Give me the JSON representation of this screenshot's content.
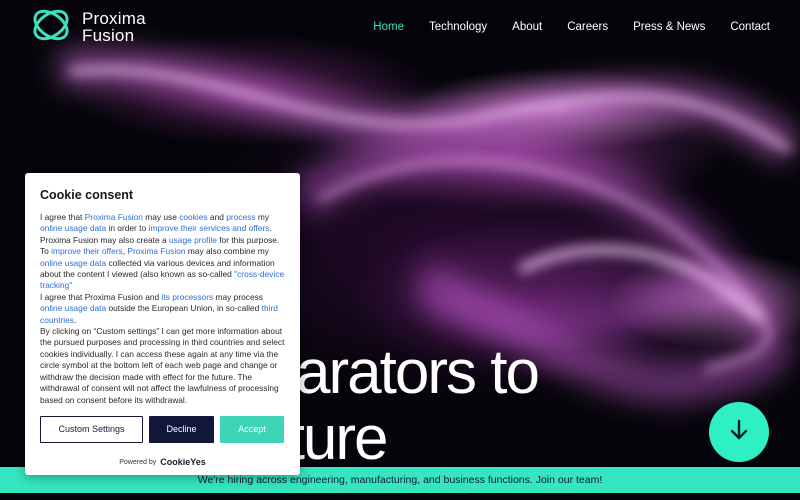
{
  "brand": {
    "line1": "Proxima",
    "line2": "Fusion"
  },
  "nav": {
    "items": [
      {
        "label": "Home"
      },
      {
        "label": "Technology"
      },
      {
        "label": "About"
      },
      {
        "label": "Careers"
      },
      {
        "label": "Press & News"
      },
      {
        "label": "Contact"
      }
    ],
    "active_color": "#3ee0bd"
  },
  "hero": {
    "line1": "ellarators to",
    "line2": "future"
  },
  "hiring_banner": "We're hiring across engineering, manufacturing, and business functions. Join our team!",
  "cookie": {
    "title": "Cookie consent",
    "p1": {
      "t1": "I agree that ",
      "l1": "Proxima Fusion",
      "t2": " may use ",
      "l2": "cookies",
      "t3": " and ",
      "l3": "process",
      "t4": " my ",
      "l4": "online usage data",
      "t5": " in order to ",
      "l5": "improve their services and offers",
      "t6": ". Proxima Fusion may also create a ",
      "l6": "usage profile",
      "t7": " for this purpose. To ",
      "l7": "improve their offers",
      "t8": ", ",
      "l8": "Proxima Fusion",
      "t9": " may also combine my ",
      "l9": "online usage data",
      "t10": " collected via various devices and information about the content I viewed (also known as so-called ",
      "l10": "\"cross-device tracking\""
    },
    "p2": {
      "t1": "I agree that Proxima Fusion and ",
      "l1": "its processors",
      "t2": " may process ",
      "l2": "online usage data",
      "t3": " outside the European Union, in so-called ",
      "l3": "third countries",
      "t4": "."
    },
    "p3": "By clicking on “Custom settings” I can get more information about the pursued purposes and processing in third countries and select cookies individually. I can access these again at any time via the circle symbol at the bottom left of each web page and change or withdraw the decision made with effect for the future. The withdrawal of consent will not affect the lawfulness of processing based on consent before its withdrawal.",
    "buttons": {
      "custom": "Custom Settings",
      "decline": "Decline",
      "accept": "Accept"
    },
    "powered_by": "Powered by",
    "powered_brand": "CookieYes"
  },
  "colors": {
    "accent": "#35e6c0",
    "link": "#2d6fd6",
    "dark_button": "#12173a"
  },
  "icons": {
    "logo": "proxima-ring-logo",
    "scroll": "arrow-down-icon"
  }
}
